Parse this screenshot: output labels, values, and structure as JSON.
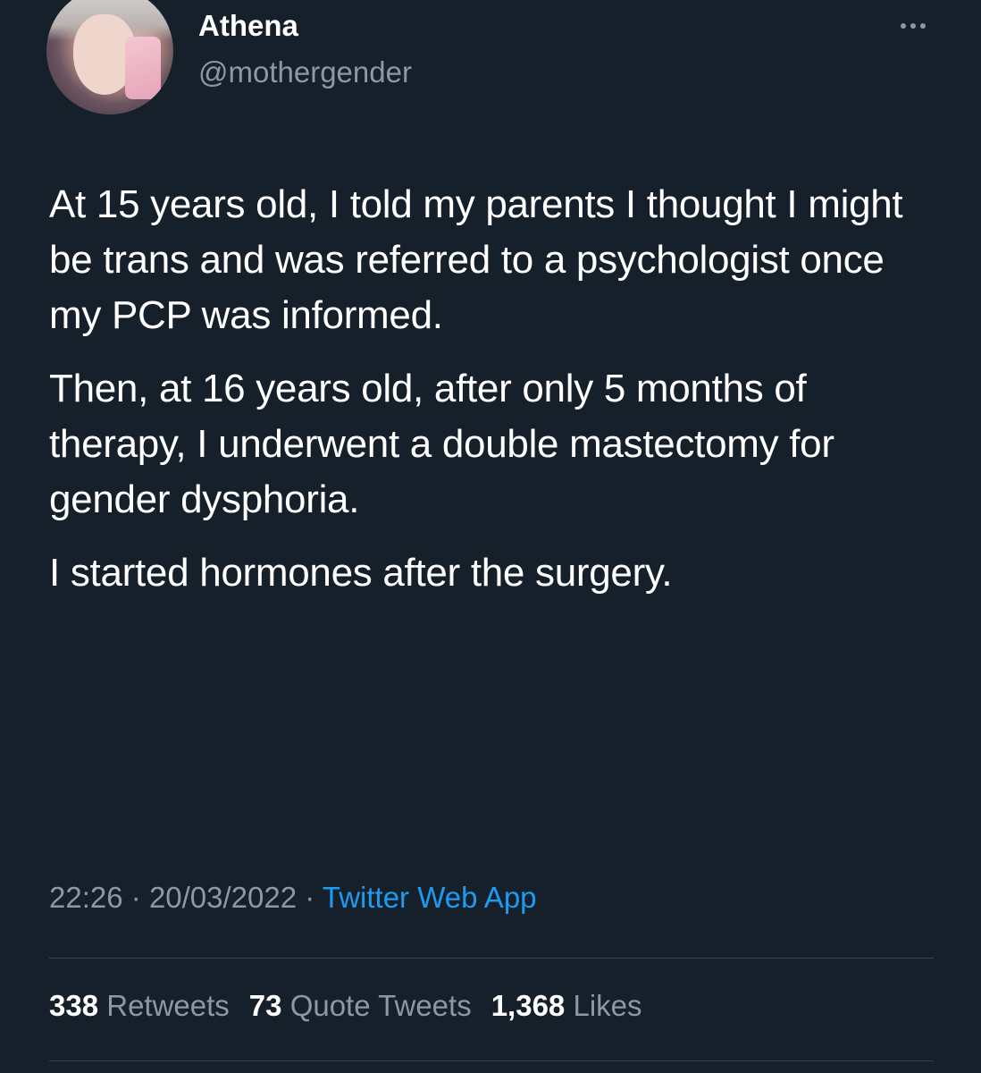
{
  "user": {
    "name": "Athena",
    "handle": "@mothergender"
  },
  "tweet": {
    "paragraphs": [
      "At 15 years old, I told my parents I thought I might be trans and was referred to a psychologist once my PCP was informed.",
      "Then, at 16 years old, after only 5 months of therapy, I underwent a double mastectomy for gender dysphoria.",
      "I started hormones after the surgery."
    ],
    "time": "22:26",
    "date": "20/03/2022",
    "separator": "·",
    "source": "Twitter Web App"
  },
  "stats": {
    "retweets_count": "338",
    "retweets_label": "Retweets",
    "quotes_count": "73",
    "quotes_label": "Quote Tweets",
    "likes_count": "1,368",
    "likes_label": "Likes"
  },
  "icons": {
    "more": "more-options-icon"
  },
  "colors": {
    "background": "#15202b",
    "text": "#ffffff",
    "secondary": "#8b98a5",
    "link": "#1d9bf0",
    "divider": "#38444d"
  }
}
